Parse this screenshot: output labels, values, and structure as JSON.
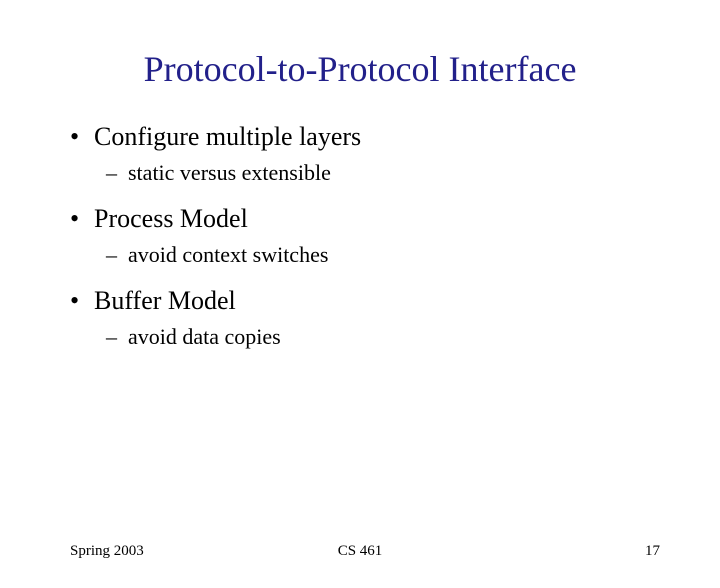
{
  "title": "Protocol-to-Protocol Interface",
  "items": [
    {
      "text": "Configure multiple layers",
      "sub": "static versus extensible"
    },
    {
      "text": "Process Model",
      "sub": "avoid context switches"
    },
    {
      "text": "Buffer Model",
      "sub": "avoid data copies"
    }
  ],
  "footer": {
    "left": "Spring 2003",
    "center": "CS 461",
    "right": "17"
  }
}
